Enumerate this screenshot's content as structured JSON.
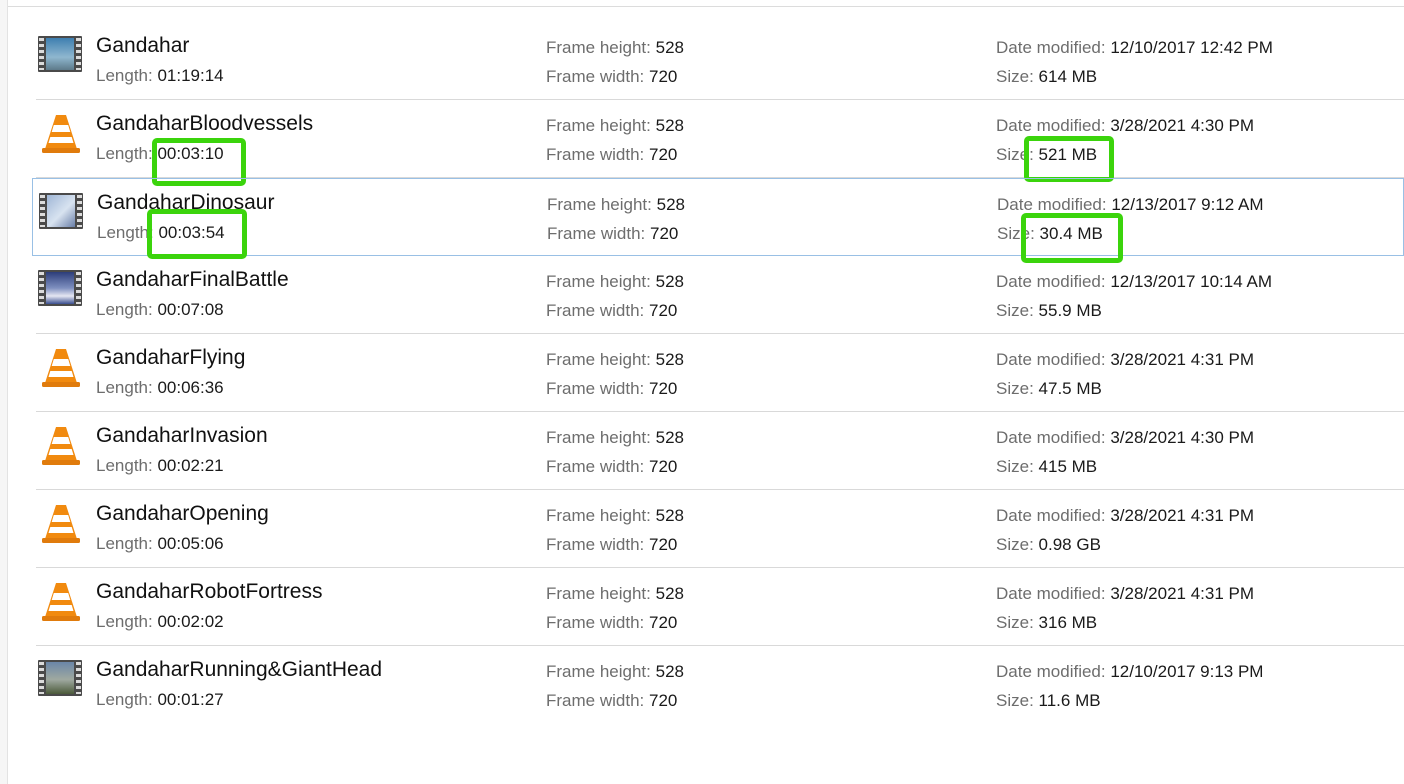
{
  "labels": {
    "length": "Length: ",
    "frame_height": "Frame height: ",
    "frame_width": "Frame width: ",
    "date_modified": "Date modified: ",
    "size": "Size: "
  },
  "files": [
    {
      "name": "Gandahar",
      "icon": "video-thumbnail-icon",
      "length": "01:19:14",
      "frame_height": "528",
      "frame_width": "720",
      "date_modified": "12/10/2017 12:42 PM",
      "size": "614 MB"
    },
    {
      "name": "GandaharBloodvessels",
      "icon": "vlc-cone-icon",
      "length": "00:03:10",
      "frame_height": "528",
      "frame_width": "720",
      "date_modified": "3/28/2021 4:30 PM",
      "size": "521 MB"
    },
    {
      "name": "GandaharDinosaur",
      "icon": "video-thumbnail-icon",
      "length": "00:03:54",
      "frame_height": "528",
      "frame_width": "720",
      "date_modified": "12/13/2017 9:12 AM",
      "size": "30.4 MB"
    },
    {
      "name": "GandaharFinalBattle",
      "icon": "video-thumbnail-icon",
      "length": "00:07:08",
      "frame_height": "528",
      "frame_width": "720",
      "date_modified": "12/13/2017 10:14 AM",
      "size": "55.9 MB"
    },
    {
      "name": "GandaharFlying",
      "icon": "vlc-cone-icon",
      "length": "00:06:36",
      "frame_height": "528",
      "frame_width": "720",
      "date_modified": "3/28/2021 4:31 PM",
      "size": "47.5 MB"
    },
    {
      "name": "GandaharInvasion",
      "icon": "vlc-cone-icon",
      "length": "00:02:21",
      "frame_height": "528",
      "frame_width": "720",
      "date_modified": "3/28/2021 4:30 PM",
      "size": "415 MB"
    },
    {
      "name": "GandaharOpening",
      "icon": "vlc-cone-icon",
      "length": "00:05:06",
      "frame_height": "528",
      "frame_width": "720",
      "date_modified": "3/28/2021 4:31 PM",
      "size": "0.98 GB"
    },
    {
      "name": "GandaharRobotFortress",
      "icon": "vlc-cone-icon",
      "length": "00:02:02",
      "frame_height": "528",
      "frame_width": "720",
      "date_modified": "3/28/2021 4:31 PM",
      "size": "316 MB"
    },
    {
      "name": "GandaharRunning&GiantHead",
      "icon": "video-thumbnail-icon",
      "length": "00:01:27",
      "frame_height": "528",
      "frame_width": "720",
      "date_modified": "12/10/2017 9:13 PM",
      "size": "11.6 MB"
    }
  ],
  "selected_file": "GandaharDinosaur",
  "annotation_color": "#3bd40c",
  "selection_border_color": "#99c0e5"
}
